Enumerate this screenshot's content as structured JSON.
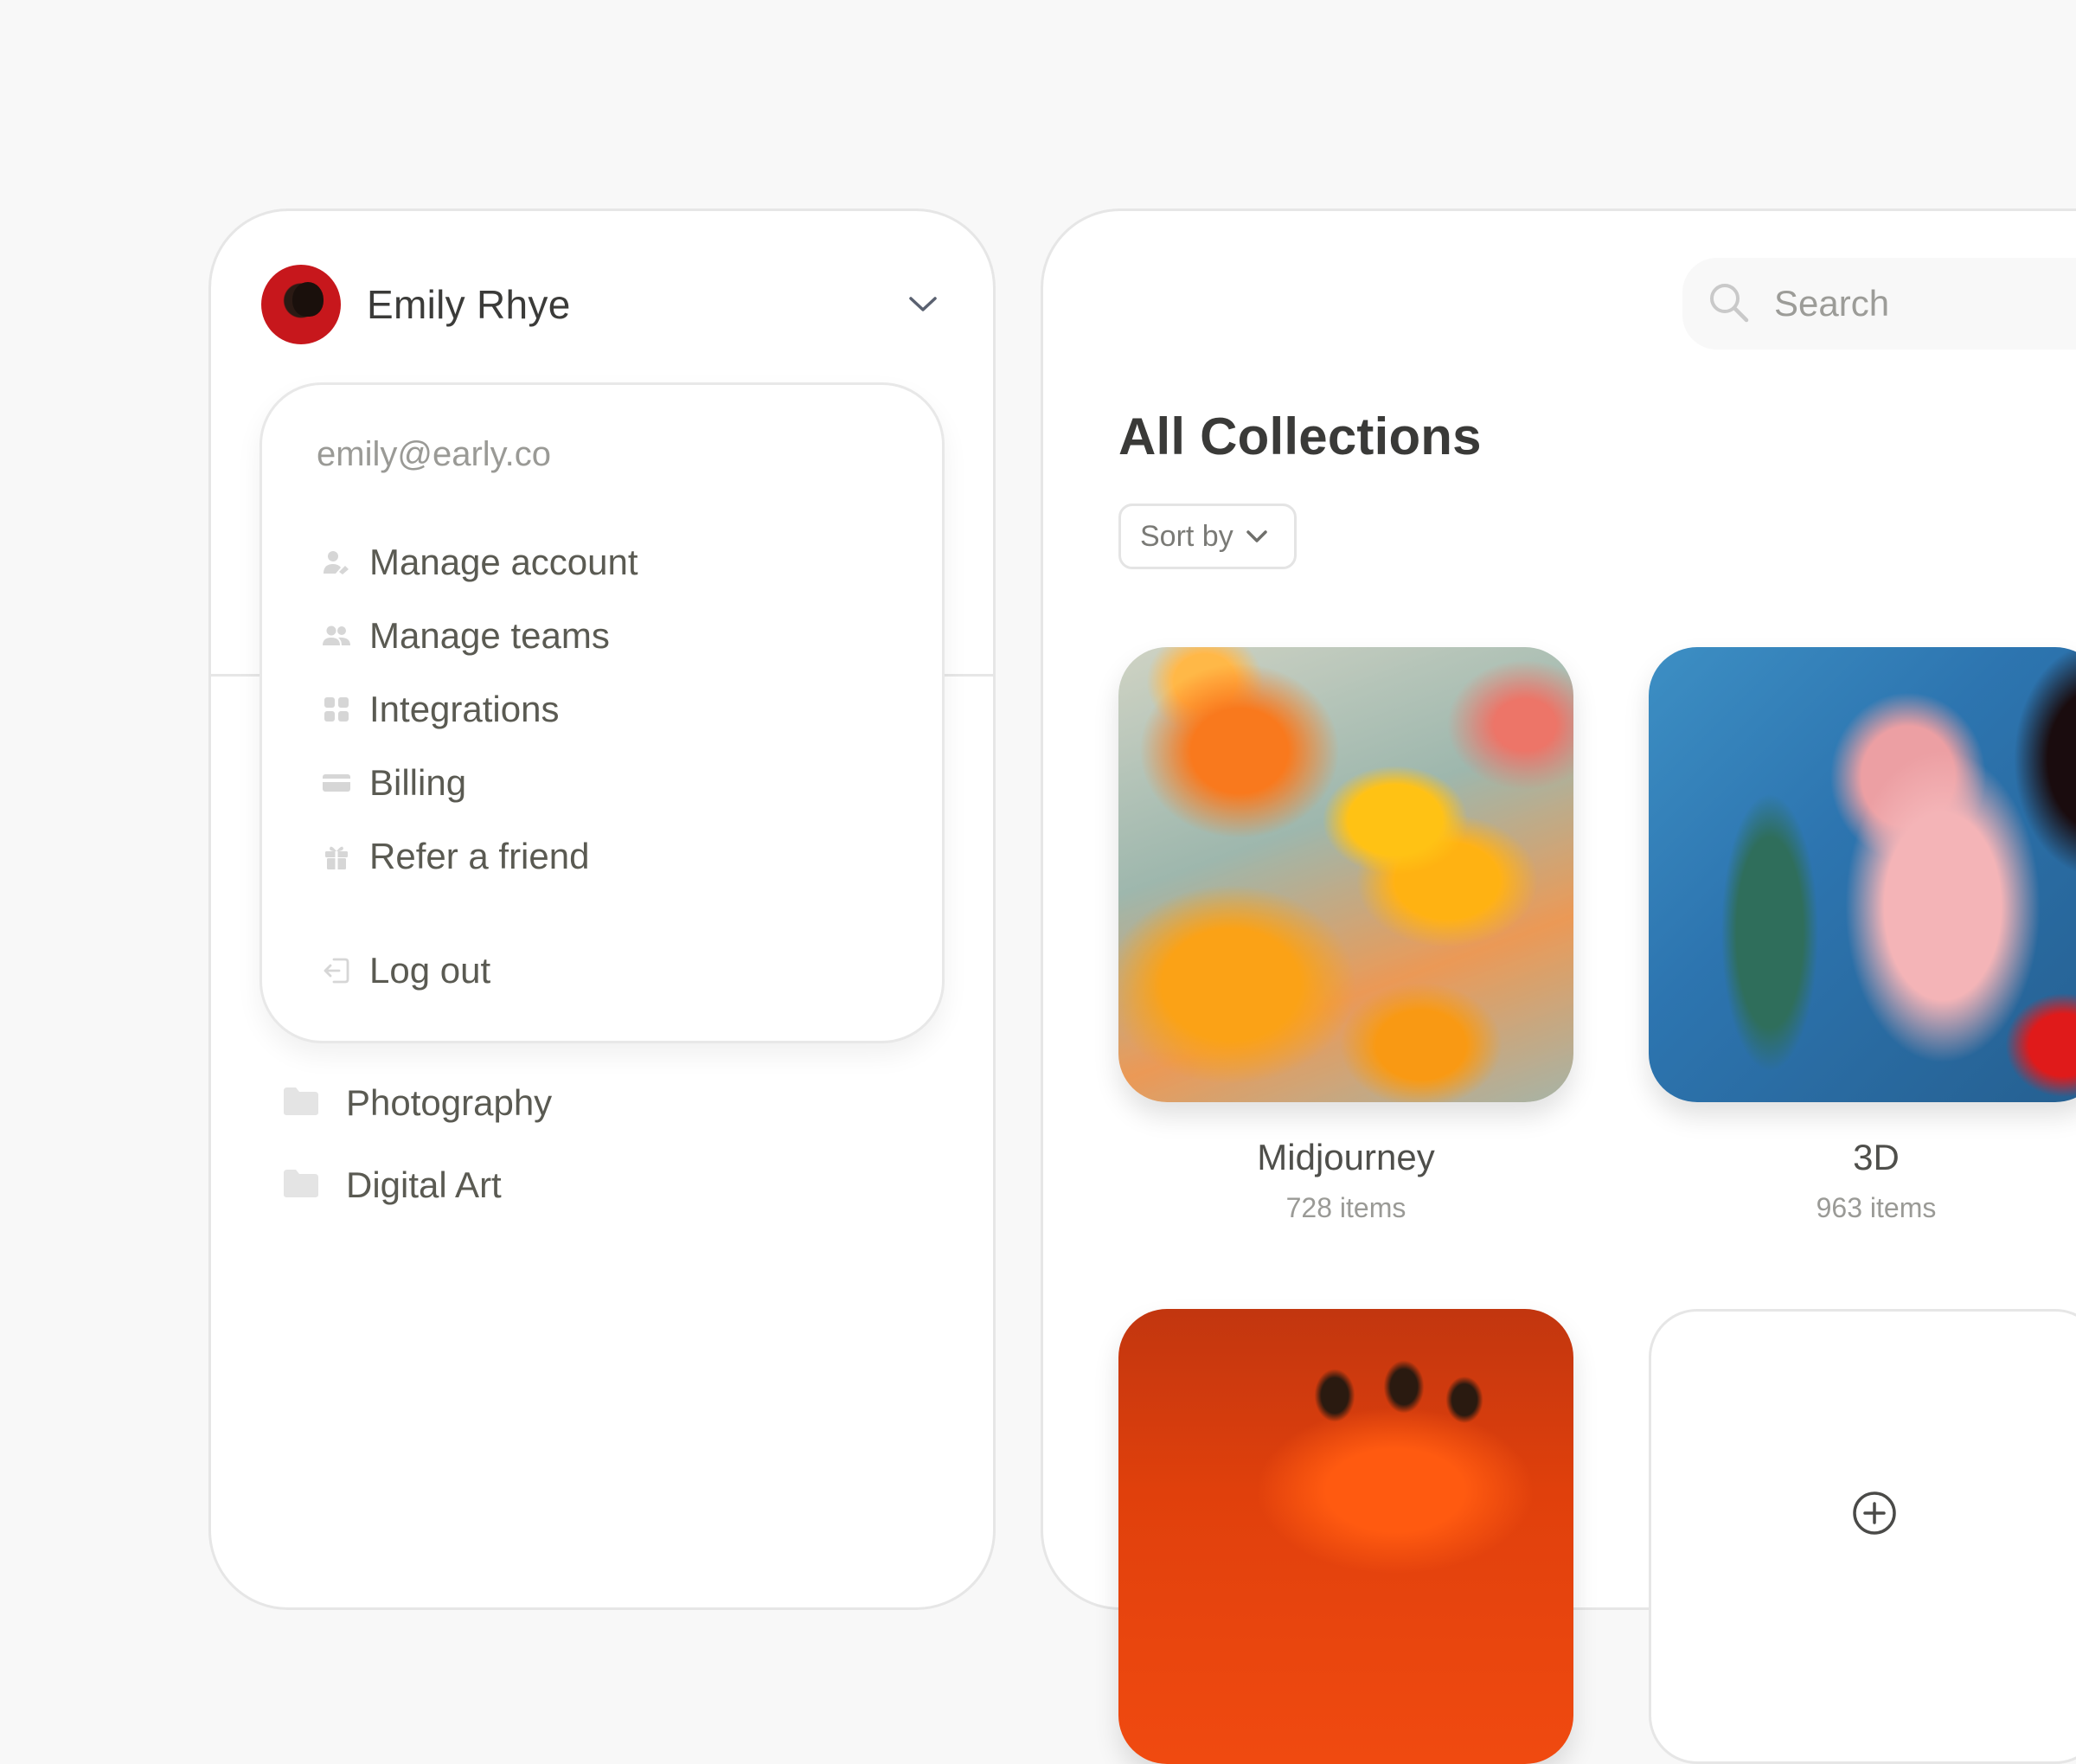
{
  "user": {
    "name": "Emily Rhye",
    "email": "emily@early.co"
  },
  "menu": {
    "items": [
      {
        "label": "Manage account",
        "icon": "user-cog-icon"
      },
      {
        "label": "Manage teams",
        "icon": "users-icon"
      },
      {
        "label": "Integrations",
        "icon": "grid-icon"
      },
      {
        "label": "Billing",
        "icon": "credit-card-icon"
      },
      {
        "label": "Refer a friend",
        "icon": "gift-icon"
      }
    ],
    "logout": {
      "label": "Log out",
      "icon": "log-out-icon"
    }
  },
  "folders": [
    {
      "label": "Photography",
      "icon": "folder-icon"
    },
    {
      "label": "Digital Art",
      "icon": "folder-icon"
    }
  ],
  "search": {
    "placeholder": "Search"
  },
  "main": {
    "title": "All Collections",
    "sort_label": "Sort by"
  },
  "collections": [
    {
      "title": "Midjourney",
      "count": "728 items"
    },
    {
      "title": "3D",
      "count": "963 items"
    }
  ],
  "colors": {
    "background": "#f8f8f8",
    "card": "#ffffff",
    "text_primary": "#3a3a38",
    "text_muted": "#9a9a96",
    "border": "#e6e6e6",
    "avatar_red": "#c7171c"
  }
}
